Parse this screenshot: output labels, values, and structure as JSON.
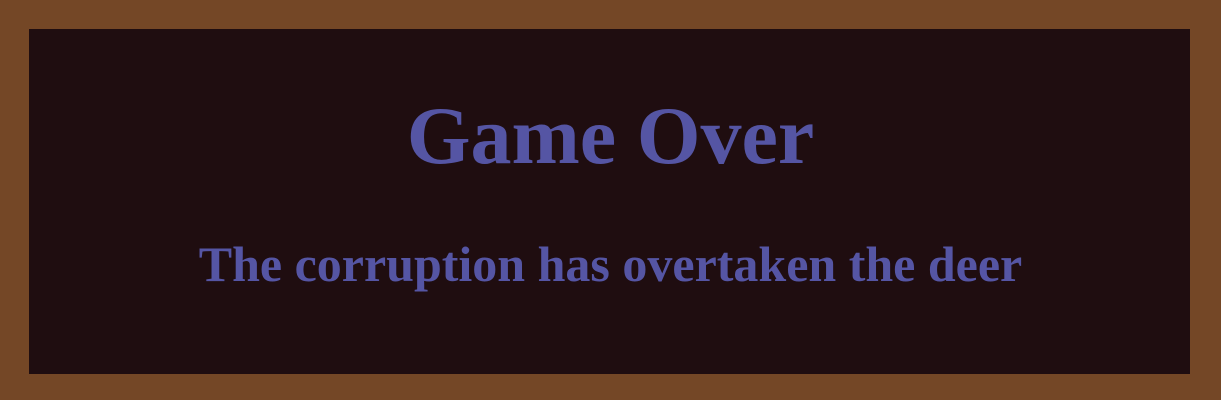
{
  "screen": {
    "title": "Game Over",
    "message": "The corruption has overtaken the deer"
  },
  "colors": {
    "frame": "#744726",
    "panel": "#1f0d10",
    "text": "#5555a4"
  }
}
